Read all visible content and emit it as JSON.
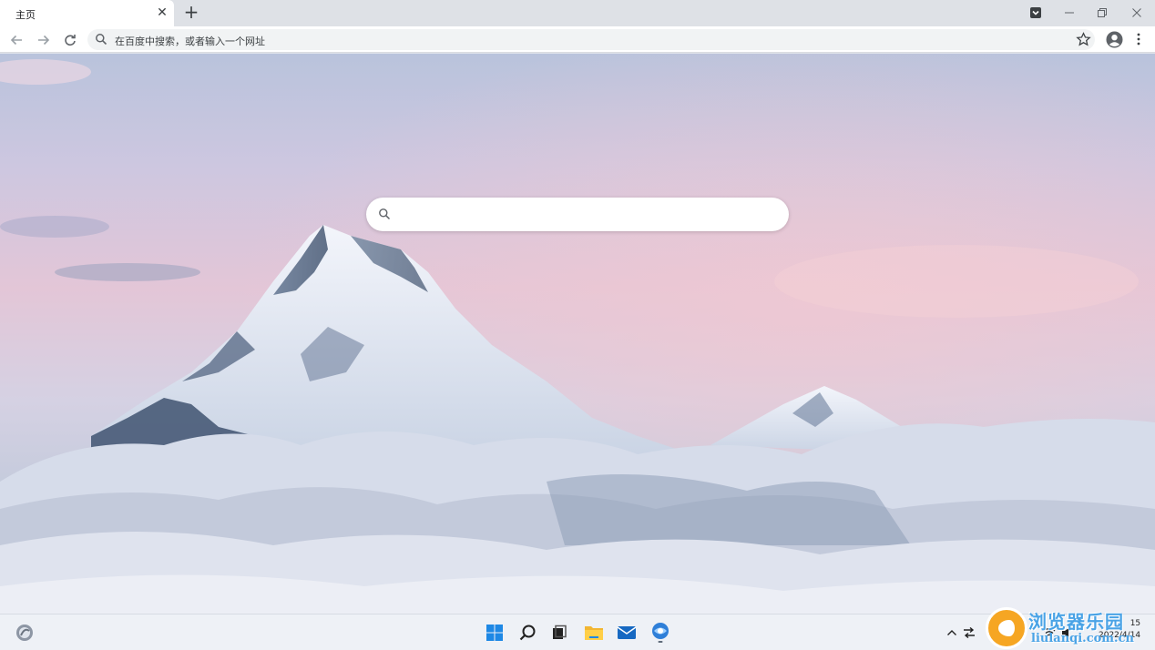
{
  "tab": {
    "title": "主页"
  },
  "omnibox": {
    "placeholder": "在百度中搜索，或者输入一个网址"
  },
  "search": {
    "placeholder": ""
  },
  "taskbar": {
    "date": "2022/4/14",
    "time": "15"
  },
  "watermark": {
    "title": "浏览器乐园",
    "url": "liulanqi.com.cn"
  },
  "colors": {
    "accent": "#4aa3e6",
    "logo": "#f6a623",
    "toolbar": "#ffffff",
    "tabstrip": "#dee1e6"
  },
  "icons": [
    "close-icon",
    "plus-icon",
    "back-icon",
    "forward-icon",
    "reload-icon",
    "search-icon",
    "star-icon",
    "profile-icon",
    "menu-icon",
    "windows-start-icon",
    "taskbar-search-icon",
    "task-view-icon",
    "file-explorer-icon",
    "mail-icon",
    "browser-icon",
    "widgets-icon",
    "chevron-up-icon",
    "network-icon",
    "volume-icon"
  ]
}
